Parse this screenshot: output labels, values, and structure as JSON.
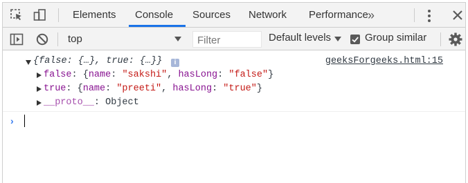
{
  "tabs": [
    "Elements",
    "Console",
    "Sources",
    "Network",
    "Performance"
  ],
  "more_tabs": "»",
  "toolbar": {
    "context": "top",
    "filter_placeholder": "Filter",
    "levels": "Default levels",
    "group_similar": "Group similar",
    "group_similar_checked": true
  },
  "log": {
    "summary": "{false: {…}, true: {…}}",
    "info_badge": "i",
    "source": "geeksForgeeks.html:15",
    "entries": [
      {
        "key": "false",
        "name": "\"sakshi\"",
        "hasLong": "\"false\""
      },
      {
        "key": "true",
        "name": "\"preeti\"",
        "hasLong": "\"true\""
      }
    ],
    "proto_key": "__proto__",
    "proto_value": "Object",
    "name_label": "name",
    "hasLong_label": "hasLong"
  },
  "colors": {
    "accent": "#1a73e8",
    "prompt": "#367cf1",
    "string": "#c41a16",
    "key": "#881391"
  }
}
